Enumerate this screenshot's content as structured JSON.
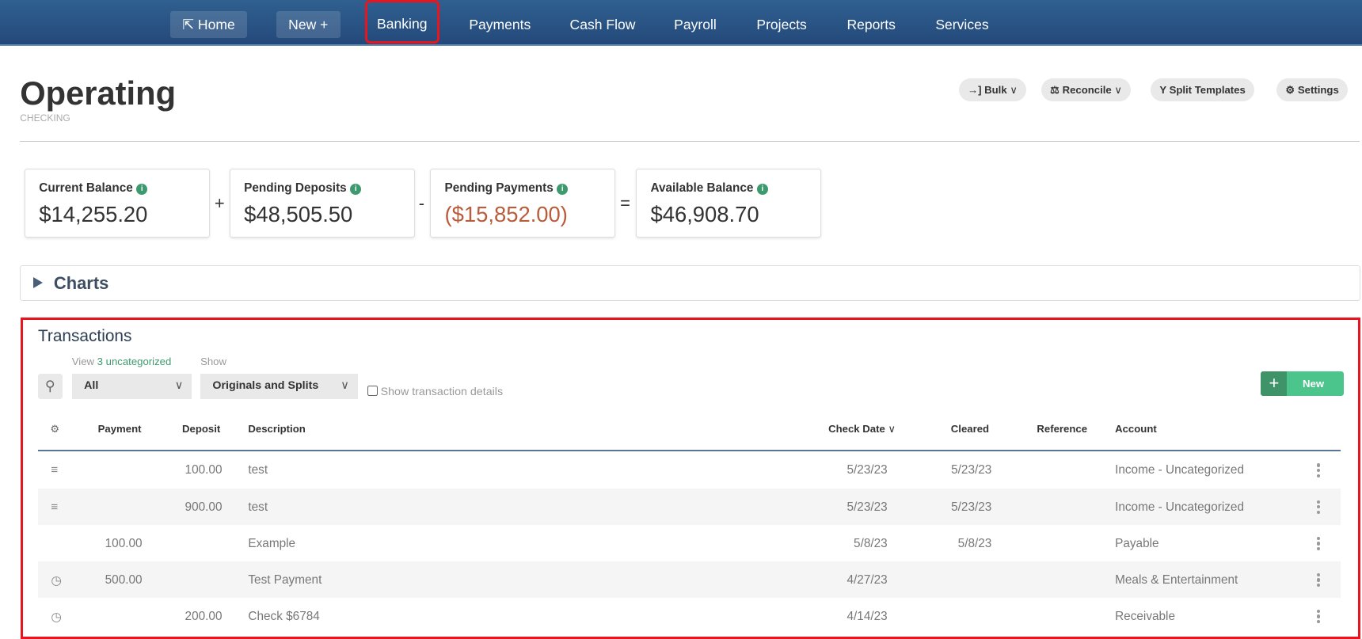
{
  "nav": {
    "home": "Home",
    "new": "New",
    "items": [
      "Banking",
      "Payments",
      "Cash Flow",
      "Payroll",
      "Projects",
      "Reports",
      "Services"
    ]
  },
  "page": {
    "title": "Operating",
    "subtitle": "CHECKING"
  },
  "toolbar": {
    "bulk": "Bulk",
    "reconcile": "Reconcile",
    "split_templates": "Split Templates",
    "settings": "Settings"
  },
  "balances": [
    {
      "label": "Current Balance",
      "value": "$14,255.20"
    },
    {
      "label": "Pending Deposits",
      "value": "$48,505.50"
    },
    {
      "label": "Pending Payments",
      "value": "($15,852.00)"
    },
    {
      "label": "Available Balance",
      "value": "$46,908.70"
    }
  ],
  "operators": [
    "+",
    "-",
    "="
  ],
  "charts": {
    "title": "Charts"
  },
  "transactions": {
    "title": "Transactions",
    "view_prefix": "View",
    "view_link": "3 uncategorized",
    "show_label": "Show",
    "view_value": "All",
    "show_value": "Originals and Splits",
    "details_label": "Show transaction details",
    "new_label": "New",
    "columns": [
      "Payment",
      "Deposit",
      "Description",
      "Check Date",
      "Cleared",
      "Reference",
      "Account"
    ],
    "rows": [
      {
        "icon": "menu",
        "payment": "",
        "deposit": "100.00",
        "description": "test",
        "check_date": "5/23/23",
        "cleared": "5/23/23",
        "reference": "",
        "account": "Income - Uncategorized"
      },
      {
        "icon": "menu",
        "payment": "",
        "deposit": "900.00",
        "description": "test",
        "check_date": "5/23/23",
        "cleared": "5/23/23",
        "reference": "",
        "account": "Income - Uncategorized"
      },
      {
        "icon": "",
        "payment": "100.00",
        "deposit": "",
        "description": "Example",
        "check_date": "5/8/23",
        "cleared": "5/8/23",
        "reference": "",
        "account": "Payable"
      },
      {
        "icon": "clock",
        "payment": "500.00",
        "deposit": "",
        "description": "Test Payment",
        "check_date": "4/27/23",
        "cleared": "",
        "reference": "",
        "account": "Meals & Entertainment"
      },
      {
        "icon": "clock",
        "payment": "",
        "deposit": "200.00",
        "description": "Check $6784",
        "check_date": "4/14/23",
        "cleared": "",
        "reference": "",
        "account": "Receivable"
      }
    ]
  },
  "colors": {
    "accent_green": "#3d9a6e",
    "negative": "#b85c3c",
    "highlight": "#e8141e"
  }
}
